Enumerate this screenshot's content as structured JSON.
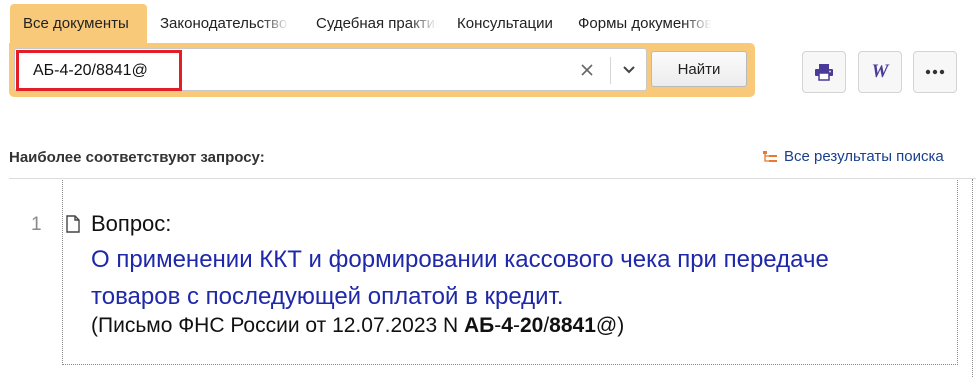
{
  "tabs": [
    {
      "label": "Все документы",
      "active": true
    },
    {
      "label": "Законодательство",
      "active": false
    },
    {
      "label": "Судебная практика",
      "active": false
    },
    {
      "label": "Консультации",
      "active": false
    },
    {
      "label": "Формы документов",
      "active": false
    }
  ],
  "search": {
    "value": "АБ-4-20/8841@",
    "find_label": "Найти"
  },
  "toolbar": {
    "print_icon": "printer-icon",
    "word_label": "W",
    "more_icon": "more-dots-icon"
  },
  "results": {
    "header": "Наиболее соответствуют запросу:",
    "all_results_label": "Все результаты поиска",
    "items": [
      {
        "number": "1",
        "label": "Вопрос:",
        "title": "О применении ККТ и формировании кассового чека при передаче товаров с последующей оплатой в кредит.",
        "source_prefix": "(Письмо ФНС России от 12.07.2023 N ",
        "source_p1": "АБ",
        "source_d1": "-",
        "source_p2": "4",
        "source_d2": "-",
        "source_p3": "20",
        "source_d3": "/",
        "source_p4": "8841",
        "source_suffix": "@)"
      }
    ]
  },
  "colors": {
    "tab_accent": "#f9c97a",
    "highlight_border": "#e41e26",
    "link": "#1e28a8"
  }
}
